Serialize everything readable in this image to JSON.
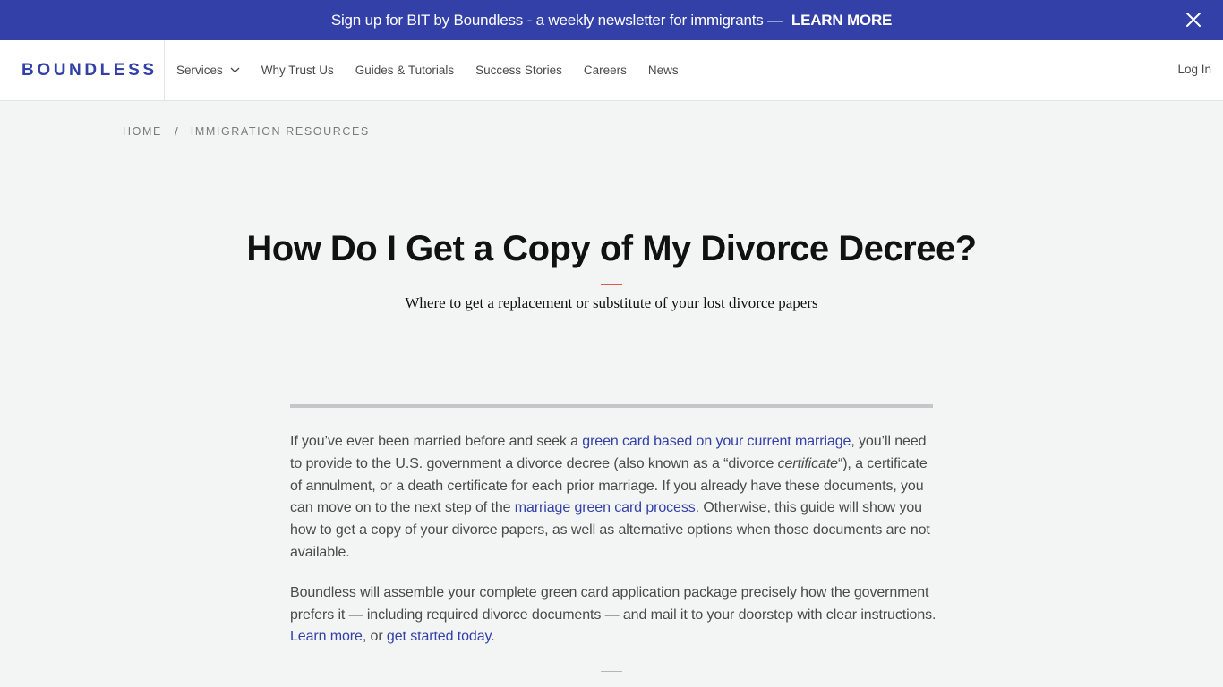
{
  "banner": {
    "message": "Sign up for BIT by Boundless - a weekly newsletter for immigrants —",
    "cta": "LEARN MORE",
    "close_icon": "close-icon"
  },
  "nav": {
    "logo": "BOUNDLESS",
    "items": [
      {
        "label": "Services",
        "has_dropdown": true
      },
      {
        "label": "Why Trust Us"
      },
      {
        "label": "Guides & Tutorials"
      },
      {
        "label": "Success Stories"
      },
      {
        "label": "Careers"
      },
      {
        "label": "News"
      }
    ],
    "login": "Log In"
  },
  "breadcrumb": {
    "home": "HOME",
    "separator": "/",
    "current": "IMMIGRATION RESOURCES"
  },
  "article": {
    "title": "How Do I Get a Copy of My Divorce Decree?",
    "subtitle": "Where to get a replacement or substitute of your lost divorce papers",
    "p1": {
      "t1": "If you’ve ever been married before and seek a ",
      "link1": "green card based on your current marriage",
      "t2": ", you’ll need to provide to the U.S. government a divorce decree (also known as a “divorce ",
      "em": "certificate",
      "t3": "“), a certificate of annulment, or a death certificate for each prior marriage. If you already have these documents, you can move on to the next step of the ",
      "link2": "marriage green card process",
      "t4": ". Otherwise, this guide will show you how to get a copy of your divorce papers, as well as alternative options when those documents are not available."
    },
    "p2": {
      "t1": "Boundless will assemble your complete green card application package precisely how the government prefers it — including required divorce documents — and mail it to your doorstep with clear instructions. ",
      "link1": "Learn more",
      "t2": ", or ",
      "link2": "get started today",
      "t3": "."
    }
  },
  "colors": {
    "brand": "#3240a8",
    "accent": "#e05a4a",
    "background": "#f3f4f4"
  }
}
